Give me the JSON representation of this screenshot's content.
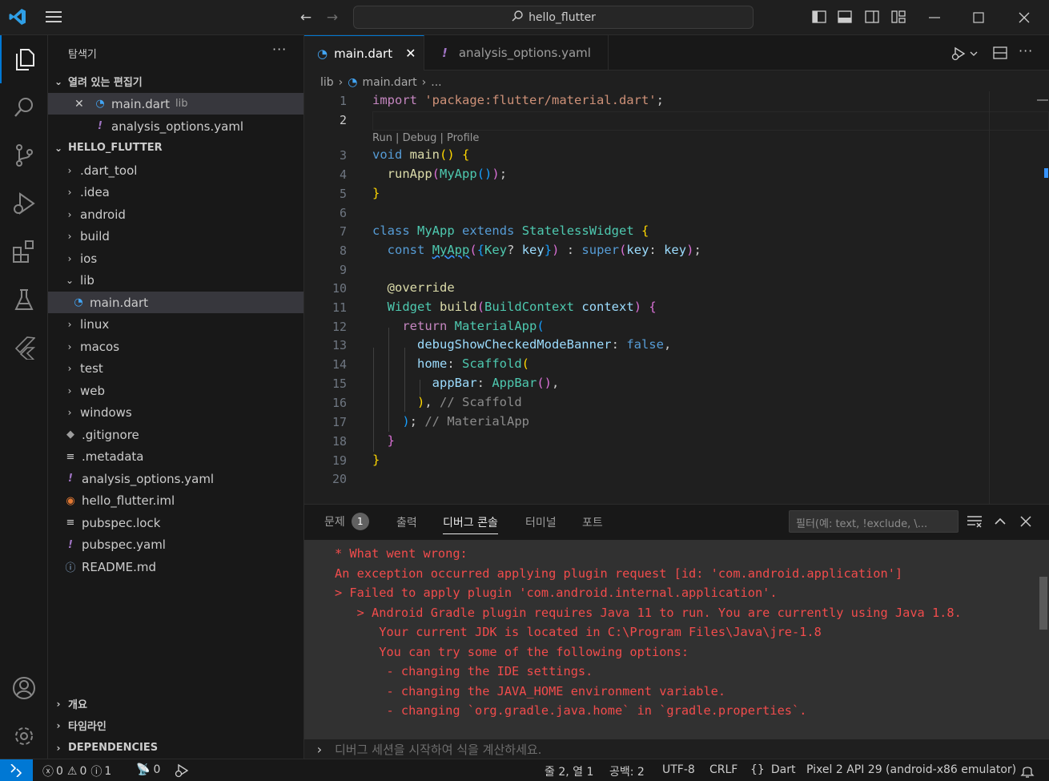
{
  "titlebar": {
    "search_text": "hello_flutter"
  },
  "sidebar": {
    "title": "탐색기",
    "open_editors_header": "열려 있는 편집기",
    "open_editors": [
      {
        "name": "main.dart",
        "detail": "lib"
      },
      {
        "name": "analysis_options.yaml"
      }
    ],
    "project_header": "HELLO_FLUTTER",
    "tree": [
      {
        "label": ".dart_tool"
      },
      {
        "label": ".idea"
      },
      {
        "label": "android"
      },
      {
        "label": "build"
      },
      {
        "label": "ios"
      },
      {
        "label": "lib"
      },
      {
        "label": "main.dart"
      },
      {
        "label": "linux"
      },
      {
        "label": "macos"
      },
      {
        "label": "test"
      },
      {
        "label": "web"
      },
      {
        "label": "windows"
      },
      {
        "label": ".gitignore"
      },
      {
        "label": ".metadata"
      },
      {
        "label": "analysis_options.yaml"
      },
      {
        "label": "hello_flutter.iml"
      },
      {
        "label": "pubspec.lock"
      },
      {
        "label": "pubspec.yaml"
      },
      {
        "label": "README.md"
      }
    ],
    "bottom_sections": [
      "개요",
      "타임라인",
      "DEPENDENCIES"
    ]
  },
  "tabs": [
    {
      "label": "main.dart",
      "active": true
    },
    {
      "label": "analysis_options.yaml",
      "active": false
    }
  ],
  "breadcrumb": {
    "folder": "lib",
    "file": "main.dart",
    "more": "..."
  },
  "editor": {
    "codelens": "Run | Debug | Profile",
    "line_numbers": [
      "1",
      "2",
      "3",
      "4",
      "5",
      "6",
      "7",
      "8",
      "9",
      "10",
      "11",
      "12",
      "13",
      "14",
      "15",
      "16",
      "17",
      "18",
      "19",
      "20"
    ],
    "current_line": "2"
  },
  "panel": {
    "tabs": [
      "문제",
      "출력",
      "디버그 콘솔",
      "터미널",
      "포트"
    ],
    "problems_count": "1",
    "active_tab": "디버그 콘솔",
    "filter_placeholder": "필터(예: text, !exclude, \\...",
    "output_lines": [
      "* What went wrong:",
      "An exception occurred applying plugin request [id: 'com.android.application']",
      "> Failed to apply plugin 'com.android.internal.application'.",
      "   > Android Gradle plugin requires Java 11 to run. You are currently using Java 1.8.",
      "      Your current JDK is located in C:\\Program Files\\Java\\jre-1.8",
      "      You can try some of the following options:",
      "       - changing the IDE settings.",
      "       - changing the JAVA_HOME environment variable.",
      "       - changing `org.gradle.java.home` in `gradle.properties`."
    ],
    "console_placeholder": "디버그 세션을 시작하여 식을 계산하세요."
  },
  "statusbar": {
    "errors": "0",
    "warnings": "0",
    "infos": "1",
    "ports": "0",
    "position": "줄 2, 열 1",
    "spaces": "공백: 2",
    "encoding": "UTF-8",
    "eol": "CRLF",
    "language": "Dart",
    "device": "Pixel 2 API 29 (android-x86 emulator)"
  },
  "colors": {
    "accent": "#0078d4",
    "error_text": "#f14c4c",
    "dart_icon": "#42a5f5",
    "yaml_icon": "#a074c4"
  }
}
